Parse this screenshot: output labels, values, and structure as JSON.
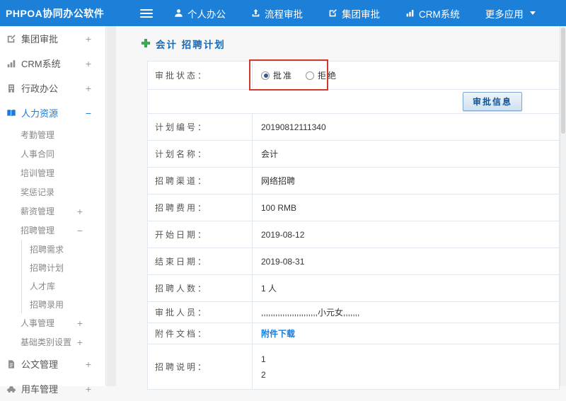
{
  "colors": {
    "topbar_blue": "#1c80d9",
    "accent_blue": "#1a7bd9",
    "title_blue": "#1a68b3",
    "annotation_red": "#d03a2b",
    "plus_green": "#3fae53"
  },
  "topbar": {
    "logo": "PHPOA协同办公软件",
    "items": [
      {
        "label": "个人办公",
        "icon": "person-icon"
      },
      {
        "label": "流程审批",
        "icon": "process-icon"
      },
      {
        "label": "集团审批",
        "icon": "edit-icon"
      },
      {
        "label": "CRM系统",
        "icon": "bar-chart-icon"
      },
      {
        "label": "更多应用",
        "icon": "caret-down-icon"
      }
    ]
  },
  "sidebar": {
    "items": [
      {
        "label": "集团审批",
        "expander": "+"
      },
      {
        "label": "CRM系统",
        "expander": "+"
      },
      {
        "label": "行政办公",
        "expander": "+"
      },
      {
        "label": "人力资源",
        "expander": "−"
      },
      {
        "label": "考勤管理"
      },
      {
        "label": "人事合同"
      },
      {
        "label": "培训管理"
      },
      {
        "label": "奖惩记录"
      },
      {
        "label": "薪资管理",
        "expander": "+"
      },
      {
        "label": "招聘管理",
        "expander": "−"
      },
      {
        "label": "招聘需求"
      },
      {
        "label": "招聘计划"
      },
      {
        "label": "人才库"
      },
      {
        "label": "招聘录用"
      },
      {
        "label": "人事管理",
        "expander": "+"
      },
      {
        "label": "基础类别设置",
        "expander": "+"
      },
      {
        "label": "公文管理",
        "expander": "+"
      },
      {
        "label": "用车管理",
        "expander": "+"
      }
    ]
  },
  "main": {
    "title": "会计 招聘计划",
    "status": {
      "label": "审批状态：",
      "options": [
        {
          "label": "批准",
          "checked": true
        },
        {
          "label": "拒绝",
          "checked": false
        }
      ]
    },
    "approve_button": "审批信息",
    "rows": [
      {
        "label": "计划编号：",
        "value": "20190812111340"
      },
      {
        "label": "计划名称：",
        "value": "会计"
      },
      {
        "label": "招聘渠道：",
        "value": "网络招聘"
      },
      {
        "label": "招聘费用：",
        "value": "100 RMB"
      },
      {
        "label": "开始日期：",
        "value": "2019-08-12"
      },
      {
        "label": "结束日期：",
        "value": "2019-08-31"
      },
      {
        "label": "招聘人数：",
        "value": "1 人"
      },
      {
        "label": "审批人员：",
        "value": ",,,,,,,,,,,,,,,,,,,,,,,,小元女,,,,,,,"
      },
      {
        "label": "附件文档：",
        "value": "附件下载"
      },
      {
        "label": "招聘说明：",
        "value": "1\n2"
      }
    ]
  }
}
